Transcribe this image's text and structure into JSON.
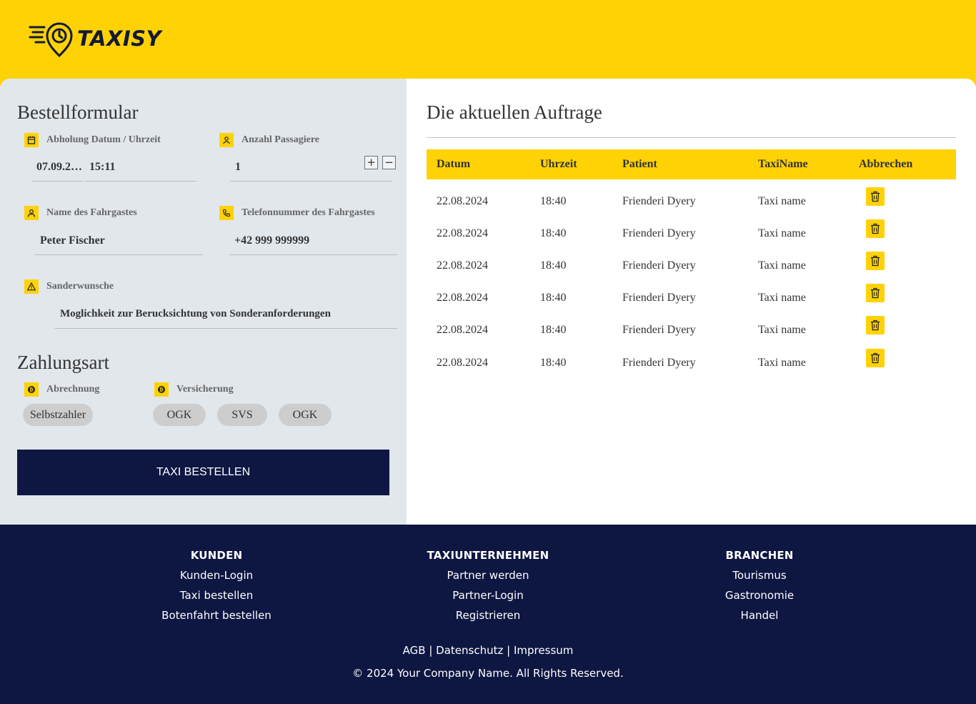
{
  "brand": {
    "name": "TAXISY",
    "logo_icon": "taxi-clock-pin-logo",
    "accent": "#fed205",
    "navy": "#0e1742"
  },
  "form": {
    "title": "Bestellformular",
    "pickup": {
      "label": "Abholung Datum / Uhrzeit",
      "icon": "calendar-icon",
      "date": "07.09.2…",
      "time": "15:11"
    },
    "passengers": {
      "label": "Anzahl Passagiere",
      "icon": "passenger-icon",
      "value": "1",
      "plus": "+",
      "minus": "−"
    },
    "name": {
      "label": "Name des Fahrgastes",
      "icon": "person-icon",
      "value": "Peter Fischer"
    },
    "phone": {
      "label": "Telefonnummer des Fahrgastes",
      "icon": "phone-icon",
      "value": "+42 999 999999"
    },
    "wishes": {
      "label": "Sanderwunsche",
      "icon": "warning-icon",
      "placeholder": "Moglichkeit zur Berucksichtung von Sonderanforderungen"
    }
  },
  "payment": {
    "title": "Zahlungsart",
    "billing": {
      "label": "Abrechnung",
      "icon": "coin-icon",
      "options": [
        "Selbstzahler"
      ]
    },
    "insurance": {
      "label": "Versicherung",
      "icon": "coin-icon",
      "options": [
        "OGK",
        "SVS",
        "OGK"
      ]
    }
  },
  "order_button": "TAXI BESTELLEN",
  "orders": {
    "title": "Die aktuellen Auftrage",
    "columns": [
      "Datum",
      "Uhrzeit",
      "Patient",
      "TaxiName",
      "Abbrechen"
    ],
    "rows": [
      {
        "date": "22.08.2024",
        "time": "18:40",
        "patient": "Frienderi Dyery",
        "taxi": "Taxi name"
      },
      {
        "date": "22.08.2024",
        "time": "18:40",
        "patient": "Frienderi Dyery",
        "taxi": "Taxi name"
      },
      {
        "date": "22.08.2024",
        "time": "18:40",
        "patient": "Frienderi Dyery",
        "taxi": "Taxi name"
      },
      {
        "date": "22.08.2024",
        "time": "18:40",
        "patient": "Frienderi Dyery",
        "taxi": "Taxi name"
      },
      {
        "date": "22.08.2024",
        "time": "18:40",
        "patient": "Frienderi Dyery",
        "taxi": "Taxi name"
      },
      {
        "date": "22.08.2024",
        "time": "18:40",
        "patient": "Frienderi Dyery",
        "taxi": "Taxi name"
      }
    ],
    "cancel_icon": "trash-icon"
  },
  "footer": {
    "columns": [
      {
        "title": "KUNDEN",
        "links": [
          "Kunden-Login",
          "Taxi bestellen",
          "Botenfahrt bestellen"
        ]
      },
      {
        "title": "TAXIUNTERNEHMEN",
        "links": [
          "Partner werden",
          "Partner-Login",
          "Registrieren"
        ]
      },
      {
        "title": "BRANCHEN",
        "links": [
          "Tourismus",
          "Gastronomie",
          "Handel"
        ]
      }
    ],
    "legal": {
      "agb": "AGB",
      "sep": "|",
      "privacy": "Datenschutz",
      "imprint": "Impressum"
    },
    "copyright": "© 2024 Your Company Name. All Rights Reserved."
  }
}
